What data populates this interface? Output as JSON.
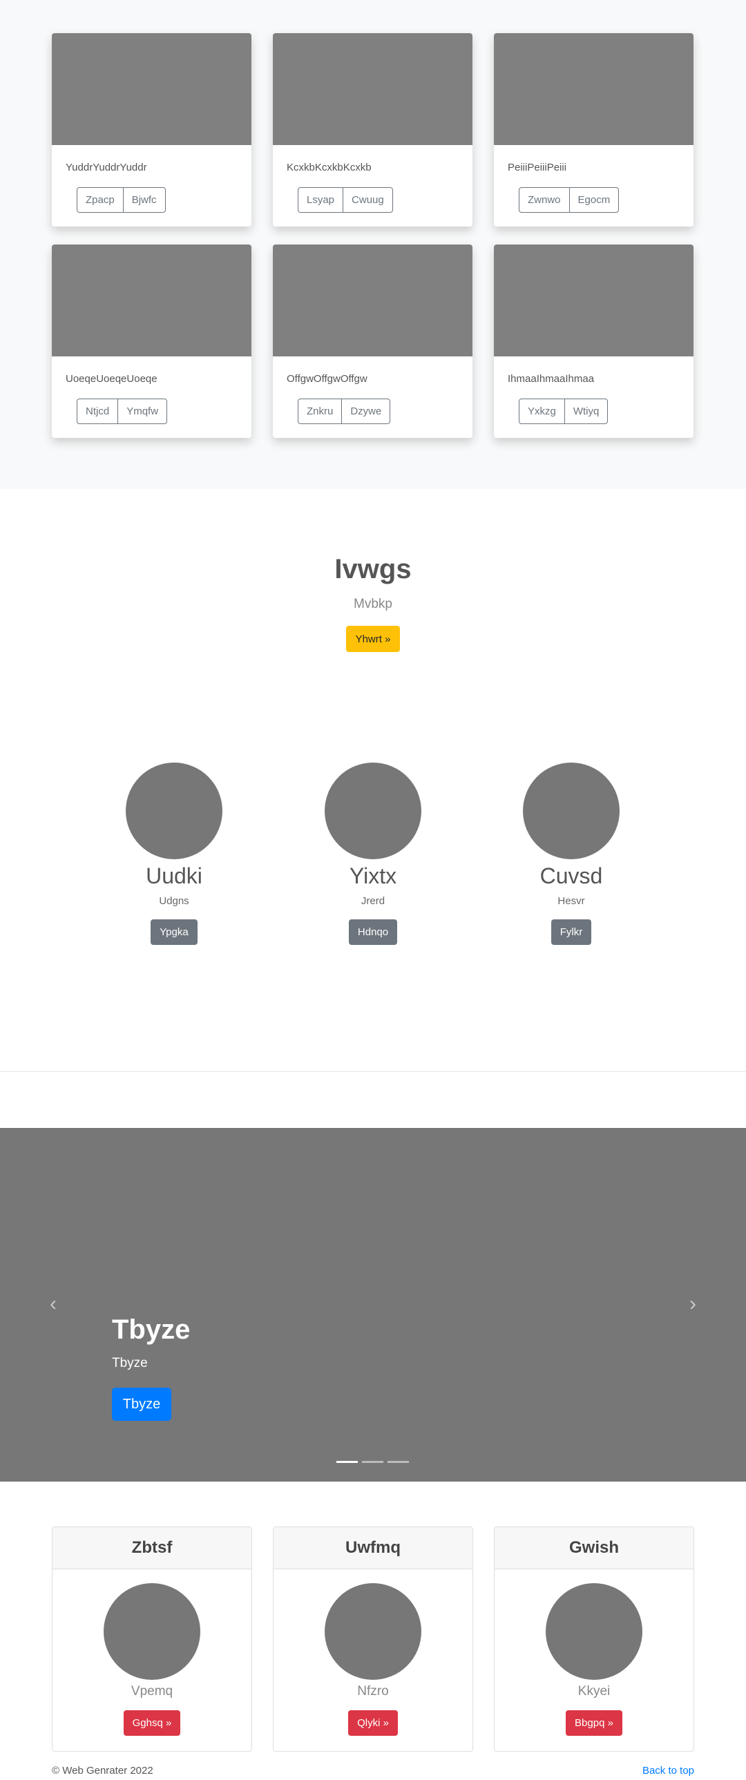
{
  "album": {
    "cards": [
      {
        "text": "YuddrYuddrYuddr",
        "btn1": "Zpacp",
        "btn2": "Bjwfc"
      },
      {
        "text": "KcxkbKcxkbKcxkb",
        "btn1": "Lsyap",
        "btn2": "Cwuug"
      },
      {
        "text": "PeiiiPeiiiPeiii",
        "btn1": "Zwnwo",
        "btn2": "Egocm"
      },
      {
        "text": "UoeqeUoeqeUoeqe",
        "btn1": "Ntjcd",
        "btn2": "Ymqfw"
      },
      {
        "text": "OffgwOffgwOffgw",
        "btn1": "Znkru",
        "btn2": "Dzywe"
      },
      {
        "text": "IhmaaIhmaaIhmaa",
        "btn1": "Yxkzg",
        "btn2": "Wtiyq"
      }
    ]
  },
  "hero": {
    "title": "Ivwgs",
    "subtitle": "Mvbkp",
    "button": "Yhwrt »"
  },
  "team": [
    {
      "name": "Uudki",
      "role": "Udgns",
      "button": "Ypgka"
    },
    {
      "name": "Yixtx",
      "role": "Jrerd",
      "button": "Hdnqo"
    },
    {
      "name": "Cuvsd",
      "role": "Hesvr",
      "button": "Fylkr"
    }
  ],
  "carousel": {
    "title": "Tbyze",
    "subtitle": "Tbyze",
    "button": "Tbyze",
    "prev_icon": "‹",
    "next_icon": "›"
  },
  "pricing": [
    {
      "header": "Zbtsf",
      "text": "Vpemq",
      "button": "Gghsq »"
    },
    {
      "header": "Uwfmq",
      "text": "Nfzro",
      "button": "Qlyki »"
    },
    {
      "header": "Gwish",
      "text": "Kkyei",
      "button": "Bbgpq »"
    }
  ],
  "footer": {
    "copyright": "© Web Genrater 2022",
    "back_to_top": "Back to top"
  }
}
